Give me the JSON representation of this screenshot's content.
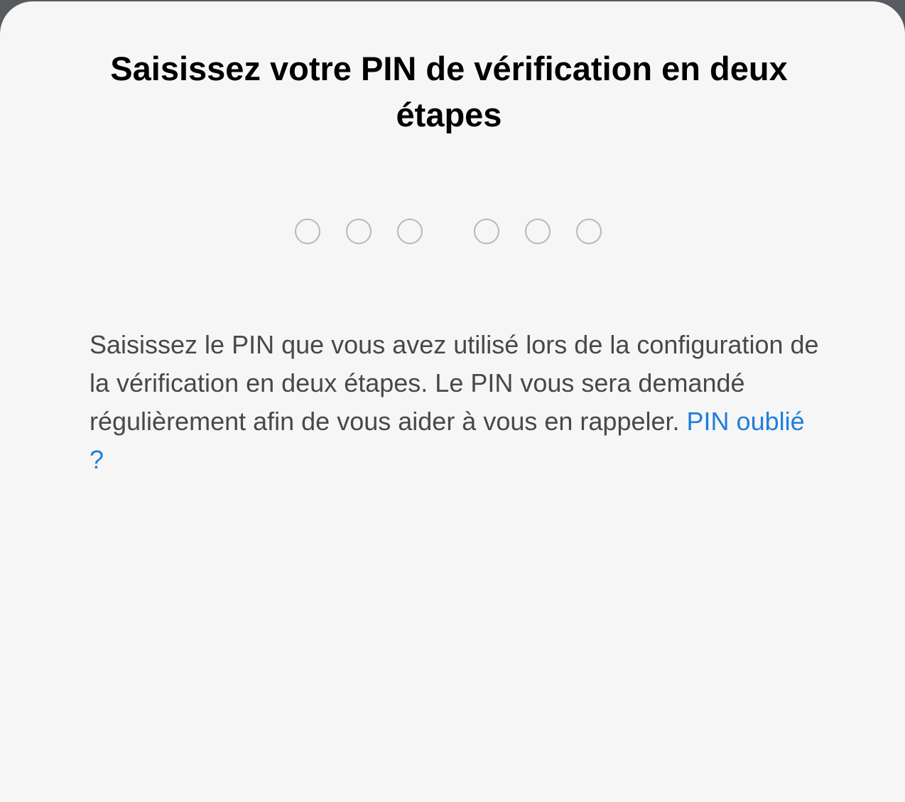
{
  "dialog": {
    "title": "Saisissez votre PIN de vérification en deux étapes",
    "pin": {
      "digit_count": 6,
      "filled_count": 0
    },
    "description": "Saisissez le PIN que vous avez utilisé lors de la configuration de la vérification en deux étapes. Le PIN vous sera demandé régulièrement afin de vous aider à vous en rappeler.",
    "forgot_link": "PIN oublié ?"
  },
  "colors": {
    "background": "#f6f6f6",
    "title": "#000000",
    "body_text": "#48484a",
    "link": "#1f7fdb",
    "pin_circle": "#b8b8b8"
  }
}
